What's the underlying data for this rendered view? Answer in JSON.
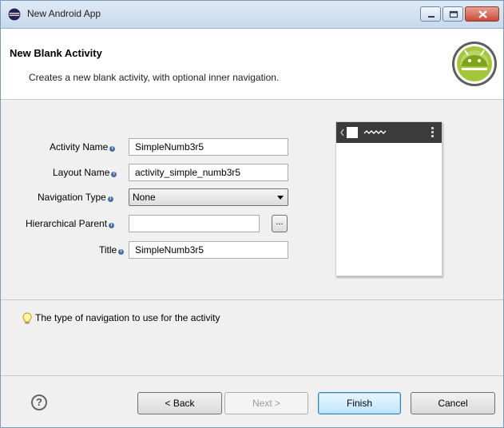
{
  "window": {
    "title": "New Android App",
    "icon": "eclipse-icon",
    "controls": [
      "minimize-icon",
      "maximize-icon",
      "close-icon"
    ]
  },
  "header": {
    "title": "New Blank Activity",
    "description": "Creates a new blank activity, with optional inner navigation.",
    "logo": "android-logo"
  },
  "form": {
    "activity_name": {
      "label": "Activity Name",
      "value": "SimpleNumb3r5"
    },
    "layout_name": {
      "label": "Layout Name",
      "value": "activity_simple_numb3r5"
    },
    "navigation_type": {
      "label": "Navigation Type",
      "value": "None"
    },
    "hierarchical_parent": {
      "label": "Hierarchical Parent",
      "value": "",
      "browse_label": "..."
    },
    "title": {
      "label": "Title",
      "value": "SimpleNumb3r5"
    },
    "info_glyph": "i"
  },
  "hint": {
    "icon": "lightbulb-icon",
    "text": "The type of navigation to use for the activity"
  },
  "buttons": {
    "help": "?",
    "back": "< Back",
    "next": "Next >",
    "finish": "Finish",
    "cancel": "Cancel"
  }
}
